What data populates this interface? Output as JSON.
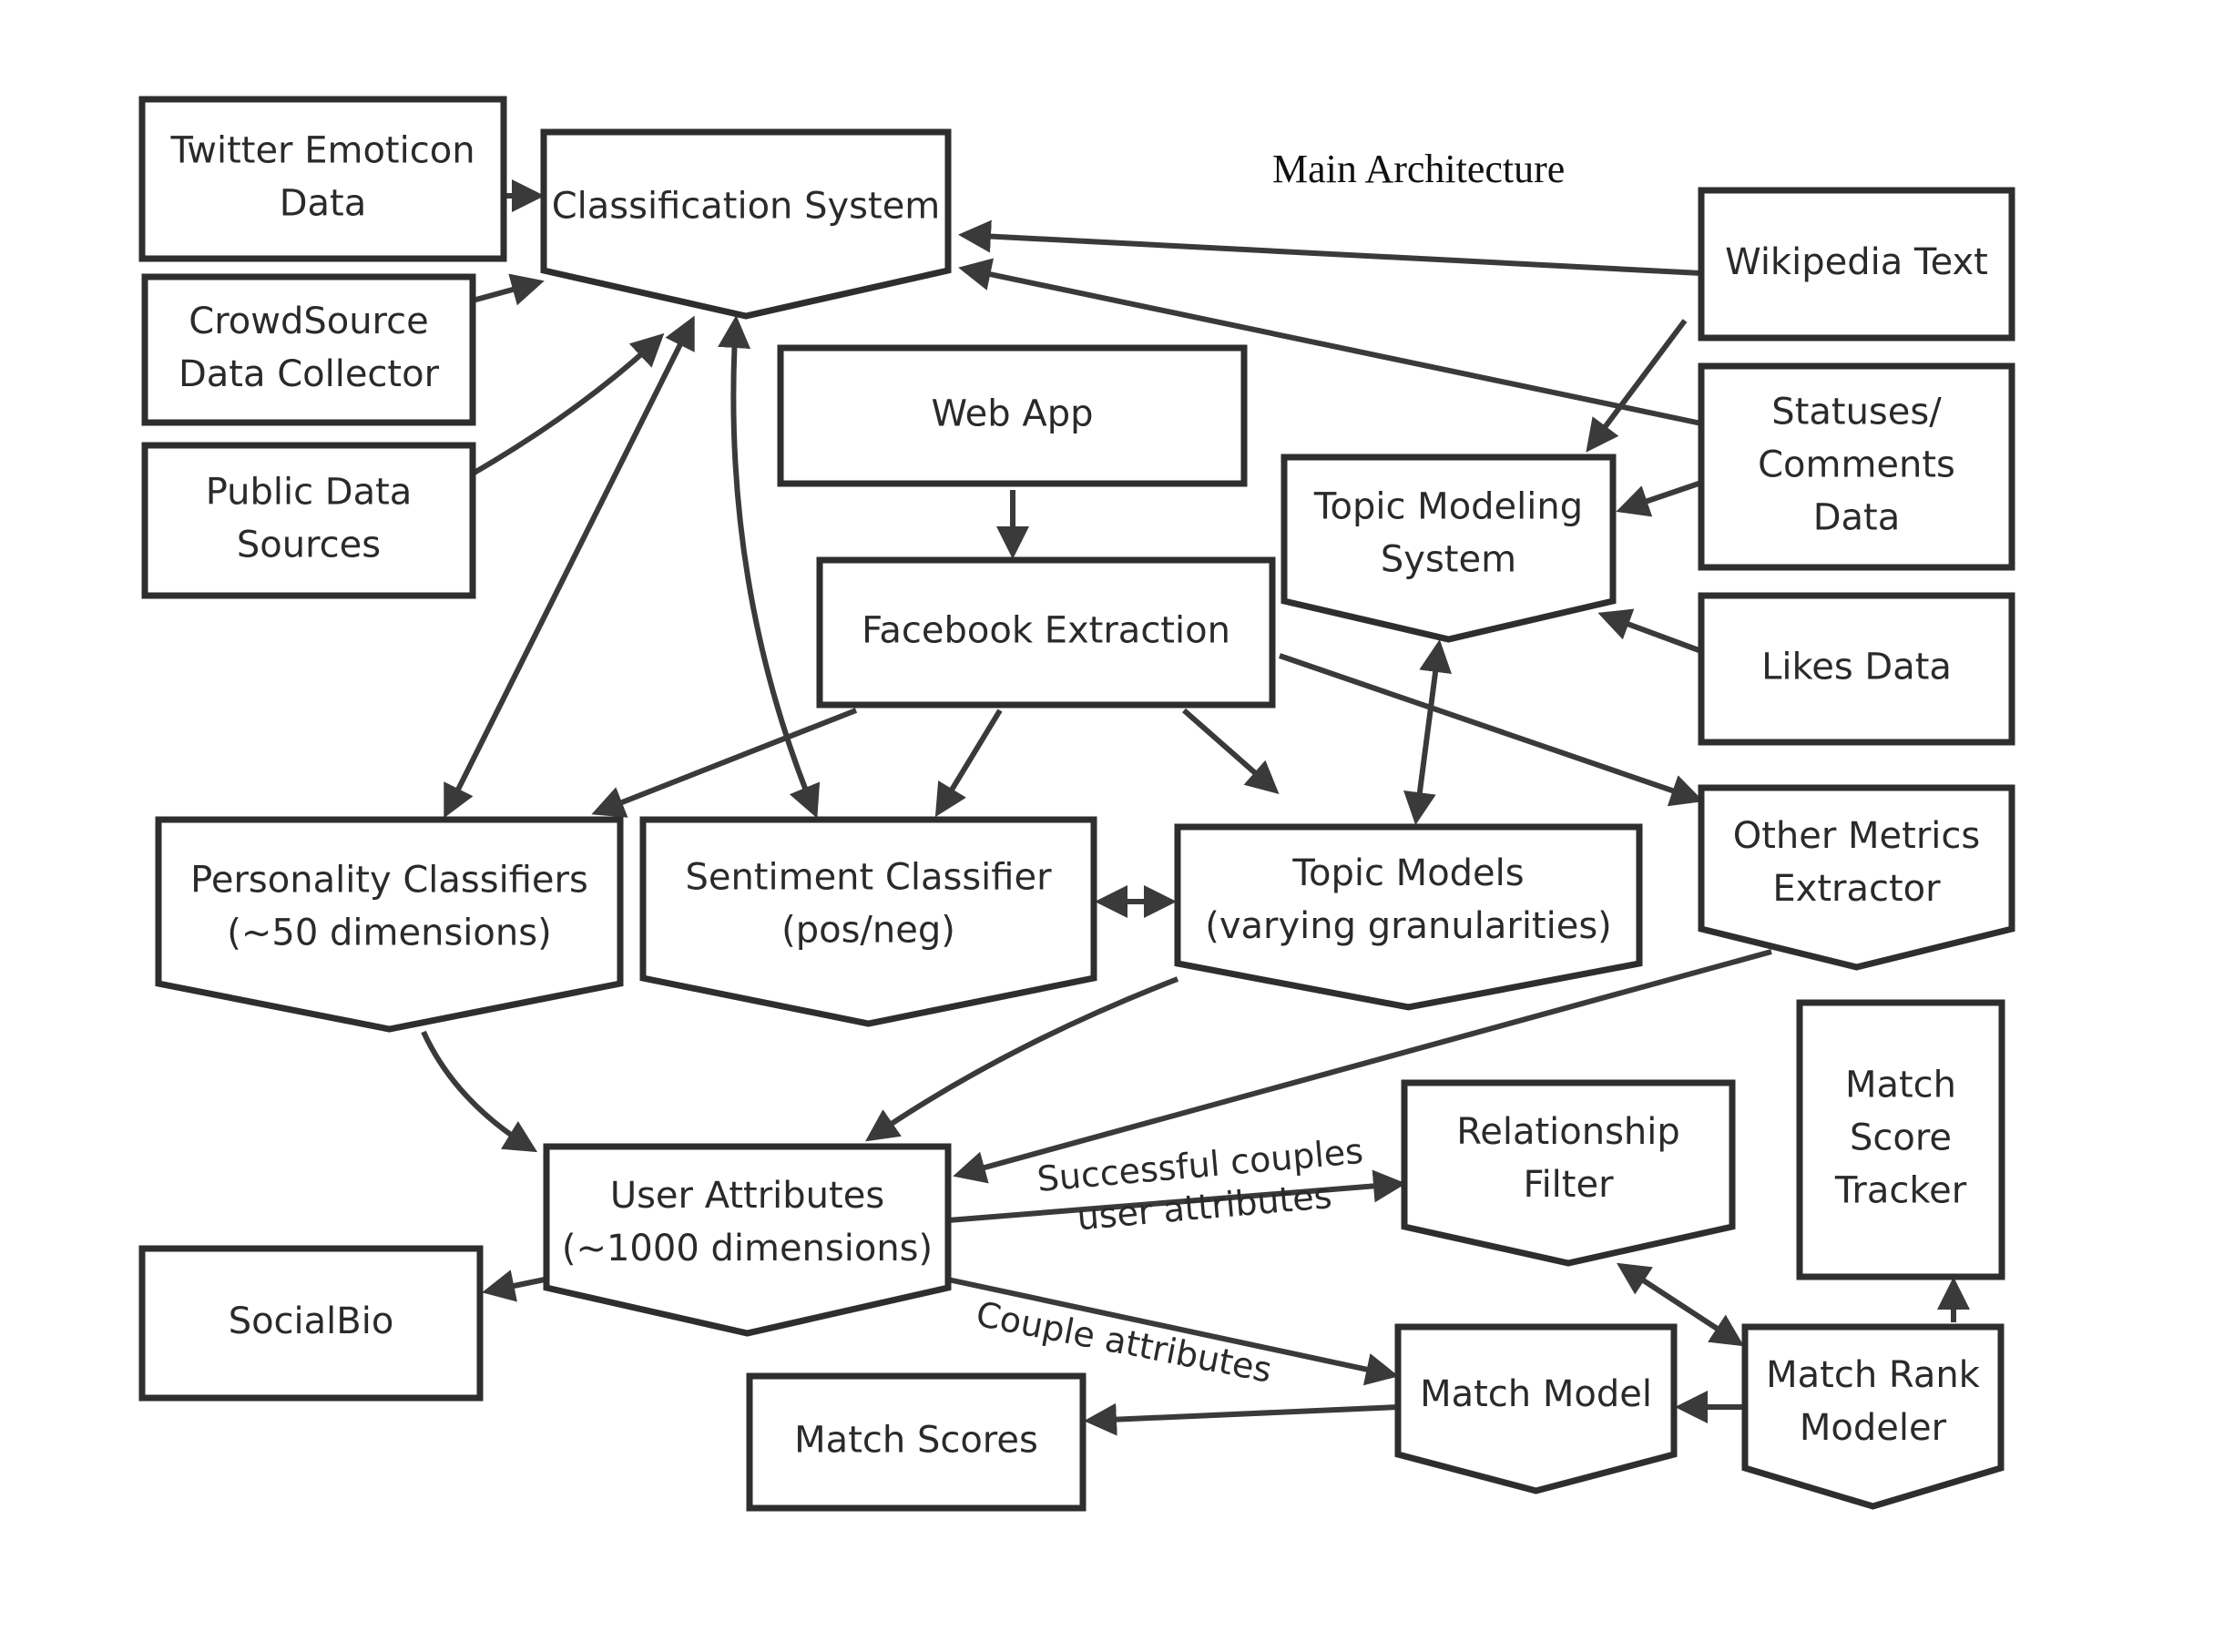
{
  "title": "Main Architecture",
  "nodes": [
    {
      "id": "twitter",
      "lines": [
        "Twitter Emoticon",
        "Data"
      ],
      "shape": "rect"
    },
    {
      "id": "classification",
      "lines": [
        "Classification System"
      ],
      "shape": "pentagon"
    },
    {
      "id": "crowdsource",
      "lines": [
        "CrowdSource",
        "Data Collector"
      ],
      "shape": "rect"
    },
    {
      "id": "public",
      "lines": [
        "Public Data",
        "Sources"
      ],
      "shape": "rect"
    },
    {
      "id": "webapp",
      "lines": [
        "Web App"
      ],
      "shape": "rect"
    },
    {
      "id": "facebook",
      "lines": [
        "Facebook Extraction"
      ],
      "shape": "rect"
    },
    {
      "id": "topicsys",
      "lines": [
        "Topic Modeling",
        "System"
      ],
      "shape": "pentagon"
    },
    {
      "id": "wikipedia",
      "lines": [
        "Wikipedia Text"
      ],
      "shape": "rect"
    },
    {
      "id": "statuses",
      "lines": [
        "Statuses/",
        "Comments",
        "Data"
      ],
      "shape": "rect"
    },
    {
      "id": "likes",
      "lines": [
        "Likes Data"
      ],
      "shape": "rect"
    },
    {
      "id": "othermetrics",
      "lines": [
        "Other Metrics",
        "Extractor"
      ],
      "shape": "pentagon"
    },
    {
      "id": "personality",
      "lines": [
        "Personality Classifiers",
        "(~50 dimensions)"
      ],
      "shape": "pentagon"
    },
    {
      "id": "sentiment",
      "lines": [
        "Sentiment Classifier",
        "(pos/neg)"
      ],
      "shape": "pentagon"
    },
    {
      "id": "topicmodels",
      "lines": [
        "Topic Models",
        "(varying granularities)"
      ],
      "shape": "pentagon"
    },
    {
      "id": "userattr",
      "lines": [
        "User Attributes",
        "(~1000 dimensions)"
      ],
      "shape": "pentagon"
    },
    {
      "id": "socialbio",
      "lines": [
        "SocialBio"
      ],
      "shape": "rect"
    },
    {
      "id": "relfilter",
      "lines": [
        "Relationship",
        "Filter"
      ],
      "shape": "pentagon"
    },
    {
      "id": "tracker",
      "lines": [
        "Match",
        "Score",
        "Tracker"
      ],
      "shape": "rect"
    },
    {
      "id": "matchmodel",
      "lines": [
        "Match Model"
      ],
      "shape": "pentagon"
    },
    {
      "id": "rankmodeler",
      "lines": [
        "Match Rank",
        "Modeler"
      ],
      "shape": "pentagon"
    },
    {
      "id": "matchscores",
      "lines": [
        "Match Scores"
      ],
      "shape": "rect"
    }
  ],
  "edges": [
    {
      "from": "twitter",
      "to": "classification",
      "direction": "forward"
    },
    {
      "from": "crowdsource",
      "to": "classification",
      "direction": "forward"
    },
    {
      "from": "public",
      "to": "classification",
      "direction": "forward"
    },
    {
      "from": "wikipedia",
      "to": "classification",
      "direction": "forward"
    },
    {
      "from": "statuses",
      "to": "classification",
      "direction": "forward"
    },
    {
      "from": "wikipedia",
      "to": "topicsys",
      "direction": "forward"
    },
    {
      "from": "statuses",
      "to": "topicsys",
      "direction": "forward"
    },
    {
      "from": "likes",
      "to": "topicsys",
      "direction": "forward"
    },
    {
      "from": "webapp",
      "to": "facebook",
      "direction": "forward"
    },
    {
      "from": "classification",
      "to": "personality",
      "direction": "both"
    },
    {
      "from": "classification",
      "to": "sentiment",
      "direction": "both"
    },
    {
      "from": "facebook",
      "to": "personality",
      "direction": "forward"
    },
    {
      "from": "facebook",
      "to": "sentiment",
      "direction": "forward"
    },
    {
      "from": "facebook",
      "to": "topicmodels",
      "direction": "forward"
    },
    {
      "from": "facebook",
      "to": "othermetrics",
      "direction": "forward"
    },
    {
      "from": "topicsys",
      "to": "topicmodels",
      "direction": "both"
    },
    {
      "from": "sentiment",
      "to": "topicmodels",
      "direction": "both"
    },
    {
      "from": "personality",
      "to": "userattr",
      "direction": "forward"
    },
    {
      "from": "topicmodels",
      "to": "userattr",
      "direction": "forward"
    },
    {
      "from": "othermetrics",
      "to": "userattr",
      "direction": "forward"
    },
    {
      "from": "userattr",
      "to": "socialbio",
      "direction": "forward"
    },
    {
      "from": "userattr",
      "to": "relfilter",
      "direction": "forward",
      "label": [
        "Successful couples",
        "user attributes"
      ]
    },
    {
      "from": "userattr",
      "to": "matchmodel",
      "direction": "forward",
      "label": [
        "Couple attributes"
      ]
    },
    {
      "from": "matchmodel",
      "to": "matchscores",
      "direction": "forward"
    },
    {
      "from": "relfilter",
      "to": "rankmodeler",
      "direction": "both"
    },
    {
      "from": "rankmodeler",
      "to": "matchmodel",
      "direction": "forward"
    },
    {
      "from": "rankmodeler",
      "to": "tracker",
      "direction": "forward"
    }
  ]
}
